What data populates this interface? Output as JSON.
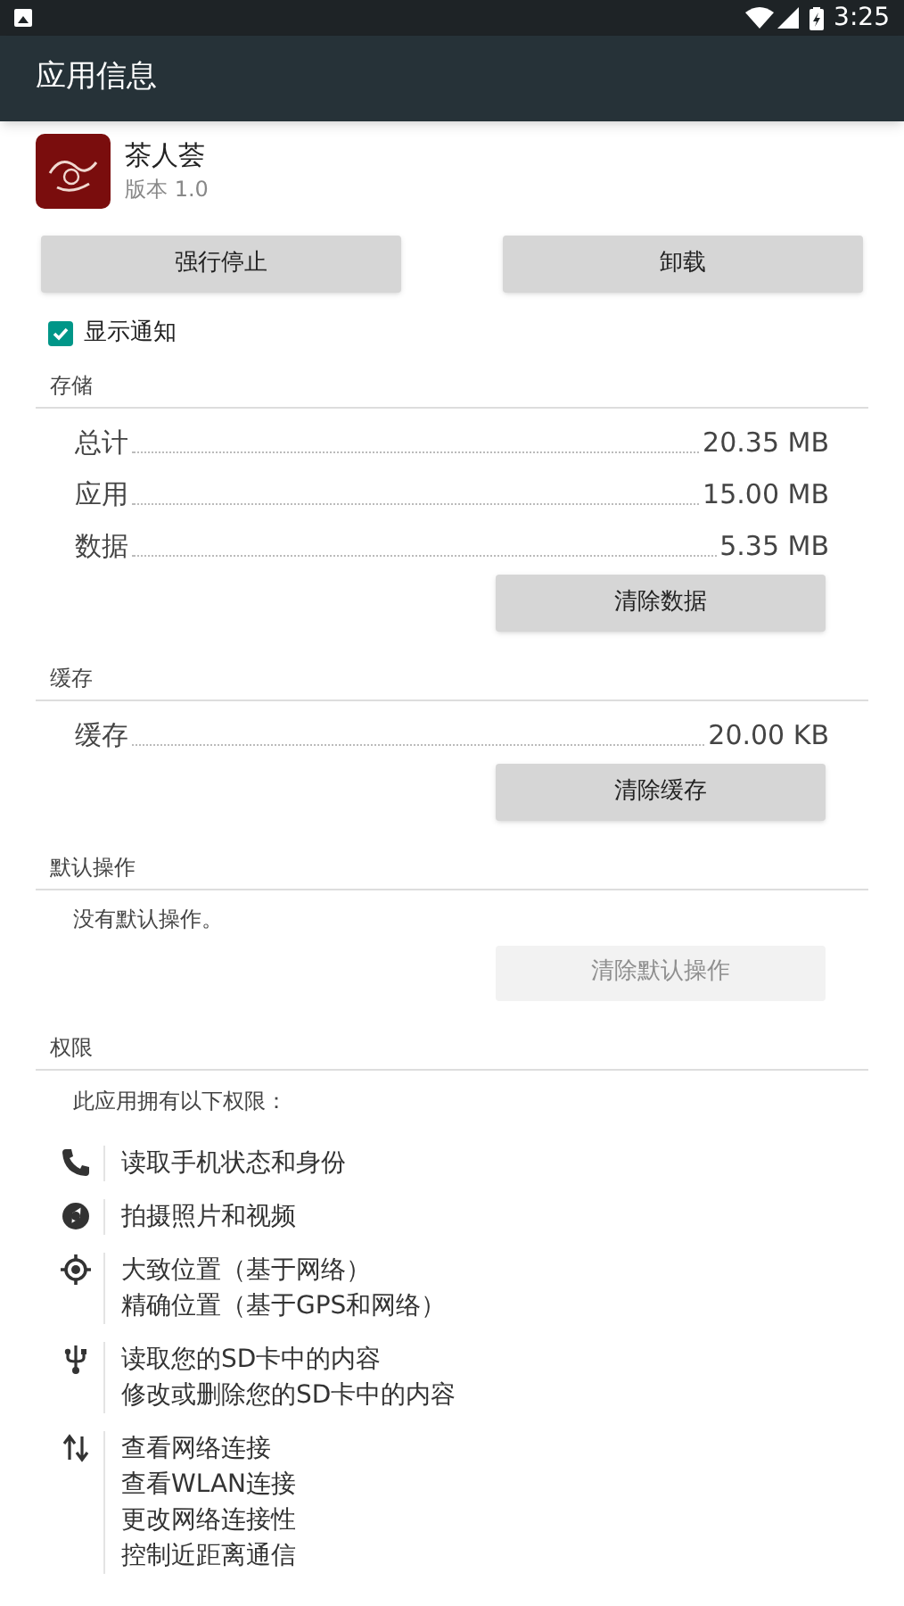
{
  "status_bar": {
    "time": "3:25"
  },
  "app_bar": {
    "title": "应用信息"
  },
  "app": {
    "name": "茶人荟",
    "version": "版本 1.0"
  },
  "actions": [
    {
      "label": "强行停止",
      "disabled": false
    },
    {
      "label": "卸载",
      "disabled": false
    }
  ],
  "notifications": {
    "label": "显示通知",
    "checked": true
  },
  "sections": [
    {
      "title": "存储",
      "rows": [
        {
          "label": "总计",
          "value": "20.35 MB"
        },
        {
          "label": "应用",
          "value": "15.00 MB"
        },
        {
          "label": "数据",
          "value": "5.35 MB"
        }
      ],
      "button": {
        "label": "清除数据",
        "disabled": false
      }
    },
    {
      "title": "缓存",
      "rows": [
        {
          "label": "缓存",
          "value": "20.00 KB"
        }
      ],
      "button": {
        "label": "清除缓存",
        "disabled": false
      }
    },
    {
      "title": "默认操作",
      "text": "没有默认操作。",
      "button": {
        "label": "清除默认操作",
        "disabled": true
      }
    }
  ],
  "permissions": {
    "title": "权限",
    "intro": "此应用拥有以下权限：",
    "groups": [
      {
        "kind": "phone",
        "lines": [
          "读取手机状态和身份"
        ]
      },
      {
        "kind": "camera",
        "lines": [
          "拍摄照片和视频"
        ]
      },
      {
        "kind": "location",
        "lines": [
          "大致位置（基于网络）",
          "精确位置（基于GPS和网络）"
        ]
      },
      {
        "kind": "usb",
        "lines": [
          "读取您的SD卡中的内容",
          "修改或删除您的SD卡中的内容"
        ]
      },
      {
        "kind": "network",
        "lines": [
          "查看网络连接",
          "查看WLAN连接",
          "更改网络连接性",
          "控制近距离通信"
        ]
      }
    ]
  }
}
